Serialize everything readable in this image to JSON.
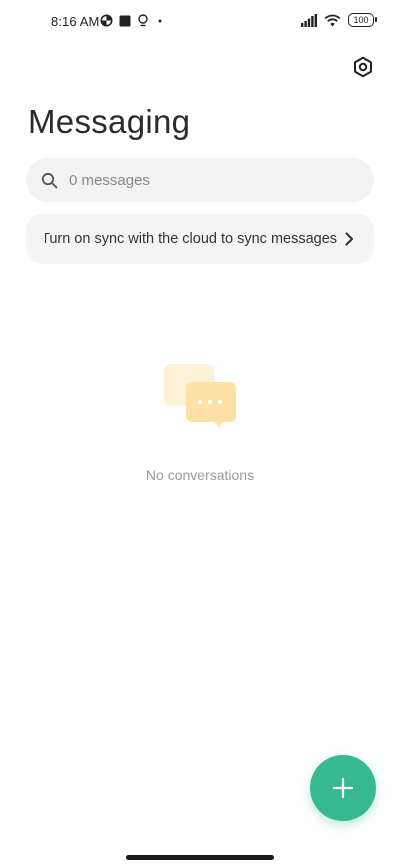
{
  "status_bar": {
    "time": "8:16 AM",
    "left_icons": [
      "data-saver-icon",
      "square-icon",
      "bulb-icon",
      "dot-icon"
    ],
    "right_icons": [
      "signal-icon",
      "wifi-icon",
      "battery-icon"
    ],
    "battery_level": "100"
  },
  "header": {
    "title": "Messaging",
    "settings_icon": "settings-icon"
  },
  "search": {
    "placeholder": "0 messages",
    "value": ""
  },
  "sync_banner": {
    "text": "Turn on sync with the cloud to sync messages"
  },
  "empty_state": {
    "text": "No conversations"
  },
  "fab": {
    "icon": "plus-icon"
  },
  "colors": {
    "accent": "#36b991",
    "surface": "#f2f2f2",
    "illustration_back": "#fdf1d8",
    "illustration_front": "#fbe1a6"
  }
}
